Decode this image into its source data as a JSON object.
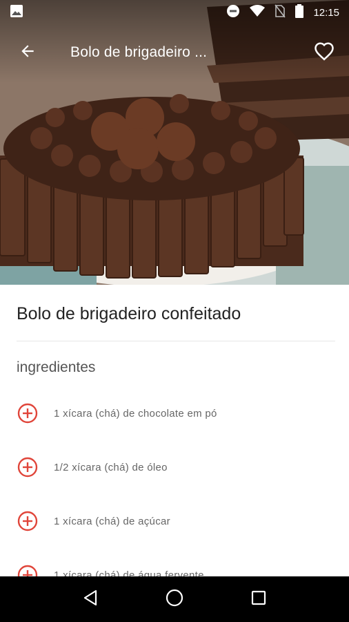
{
  "status_bar": {
    "time": "12:15",
    "icons": [
      "image-icon",
      "do-not-disturb-icon",
      "wifi-icon",
      "no-sim-icon",
      "battery-icon"
    ]
  },
  "toolbar": {
    "title": "Bolo de brigadeiro ...",
    "back_icon": "arrow-back-icon",
    "favorite_icon": "heart-outline-icon"
  },
  "recipe": {
    "title": "Bolo de brigadeiro confeitado",
    "ingredients_heading": "ingredientes",
    "ingredients": [
      "1 xícara (chá) de chocolate em pó",
      "1/2 xícara (chá) de óleo",
      "1 xícara (chá) de açúcar",
      "1 xícara (chá) de água fervente"
    ]
  },
  "nav_bar": {
    "icons": [
      "back-triangle-icon",
      "home-circle-icon",
      "recents-square-icon"
    ]
  },
  "colors": {
    "accent": "#e0453a",
    "title_text": "#222222",
    "body_text": "#666666",
    "nav_bar": "#000000"
  }
}
